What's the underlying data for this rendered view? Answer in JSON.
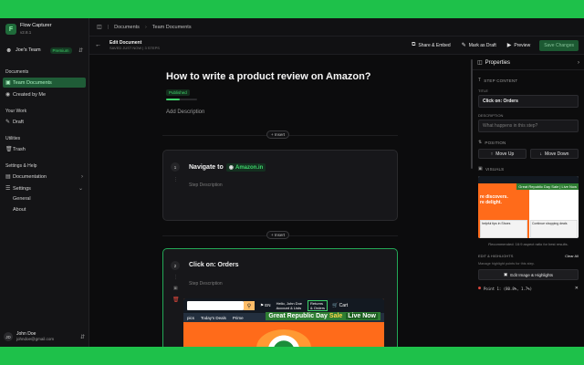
{
  "brand": {
    "name": "Flow Capturer",
    "version": "v2.8.1",
    "logo": "F"
  },
  "team": {
    "name": "Joe's Team",
    "badge": "Premium"
  },
  "sidebar": {
    "documents_label": "Documents",
    "team_documents": "Team Documents",
    "created_by_me": "Created by Me",
    "your_work_label": "Your Work",
    "draft": "Draft",
    "utilities_label": "Utilities",
    "trash": "Trash",
    "settings_help_label": "Settings & Help",
    "documentation": "Documentation",
    "settings": "Settings",
    "general": "General",
    "about": "About"
  },
  "user": {
    "initials": "JD",
    "name": "John Doe",
    "email": "johndoe@gmail.com"
  },
  "breadcrumb": {
    "root": "Documents",
    "current": "Team Documents"
  },
  "editor": {
    "title": "Edit Document",
    "subtitle": "SAVED JUST NOW | 3 STEPS",
    "share_label": "Share & Embed",
    "draft_label": "Mark as Draft",
    "preview_label": "Preview",
    "save_label": "Save Changes"
  },
  "doc": {
    "title": "How to write a product review on Amazon?",
    "status": "Published",
    "progress": 0.45,
    "add_description": "Add Description",
    "insert_label": "Insert"
  },
  "steps": [
    {
      "num": "1",
      "title": "Navigate to",
      "site": "Amazon.in",
      "description": "Step Description"
    },
    {
      "num": "2",
      "title": "Click on: Orders",
      "description": "Step Description"
    }
  ],
  "screenshot": {
    "lang": "EN",
    "account_line1": "Hello, John Doe",
    "account_line2": "Account & Lists",
    "orders_line1": "Returns",
    "orders_line2": "& Orders",
    "cart": "Cart",
    "nav": [
      "pics",
      "Today's Deals",
      "Prime"
    ],
    "banner_a": "Great Republic Day",
    "banner_b": "Sale",
    "banner_c": "Live Now"
  },
  "panel": {
    "title": "Properties",
    "step_content": "STEP CONTENT",
    "title_label": "TITLE",
    "title_value": "Click on: Orders",
    "description_label": "DESCRIPTION",
    "description_placeholder": "What happens in this step?",
    "position_label": "POSITION",
    "move_up": "Move Up",
    "move_down": "Move Down",
    "visuals_label": "VISUALS",
    "visual_discover": "re discovers.",
    "visual_delight": "re delight.",
    "visual_banner": "Great Republic Day Sale | Live Now",
    "visual_card1": "helpful tips in Shoes",
    "visual_card2": "Continue shopping deals",
    "visual_hint": "Recommended: 16:9 aspect ratio for best results.",
    "edit_highlights_label": "EDIT & HIGHLIGHTS",
    "clear_all": "Clear All",
    "edit_hint": "Manage highlight points for this step.",
    "edit_image_button": "Edit Image & Highlights",
    "point_label": "Point 1: (80.8%, 1.7%)"
  }
}
